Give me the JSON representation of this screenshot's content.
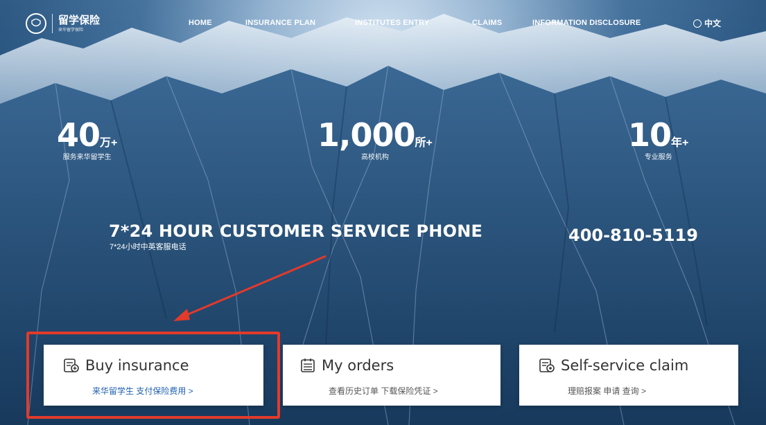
{
  "brand": {
    "name": "留学保险",
    "tagline": "来华留学保险"
  },
  "nav": {
    "items": [
      "HOME",
      "INSURANCE PLAN",
      "INSTITUTES ENTRY",
      "CLAIMS",
      "INFORMATION DISCLOSURE"
    ],
    "language": "中文"
  },
  "stats": [
    {
      "value": "40",
      "unit": "万+",
      "caption": "服务来华留学生"
    },
    {
      "value": "1,000",
      "unit": "所+",
      "caption": "高校机构"
    },
    {
      "value": "10",
      "unit": "年+",
      "caption": "专业服务"
    }
  ],
  "service": {
    "title": "7*24 HOUR CUSTOMER SERVICE PHONE",
    "subtitle": "7*24小时中英客服电话",
    "phone": "400-810-5119"
  },
  "cards": {
    "buy": {
      "title": "Buy insurance",
      "desc": "来华留学生 支付保险费用 >"
    },
    "orders": {
      "title": "My orders",
      "desc": "查看历史订单 下载保险凭证 >"
    },
    "claim": {
      "title": "Self-service claim",
      "desc": "理赔报案 申请 查询 >"
    }
  },
  "colors": {
    "accent_link": "#1f5fb0",
    "highlight": "#e23a2b",
    "desc_gray": "#555555"
  }
}
